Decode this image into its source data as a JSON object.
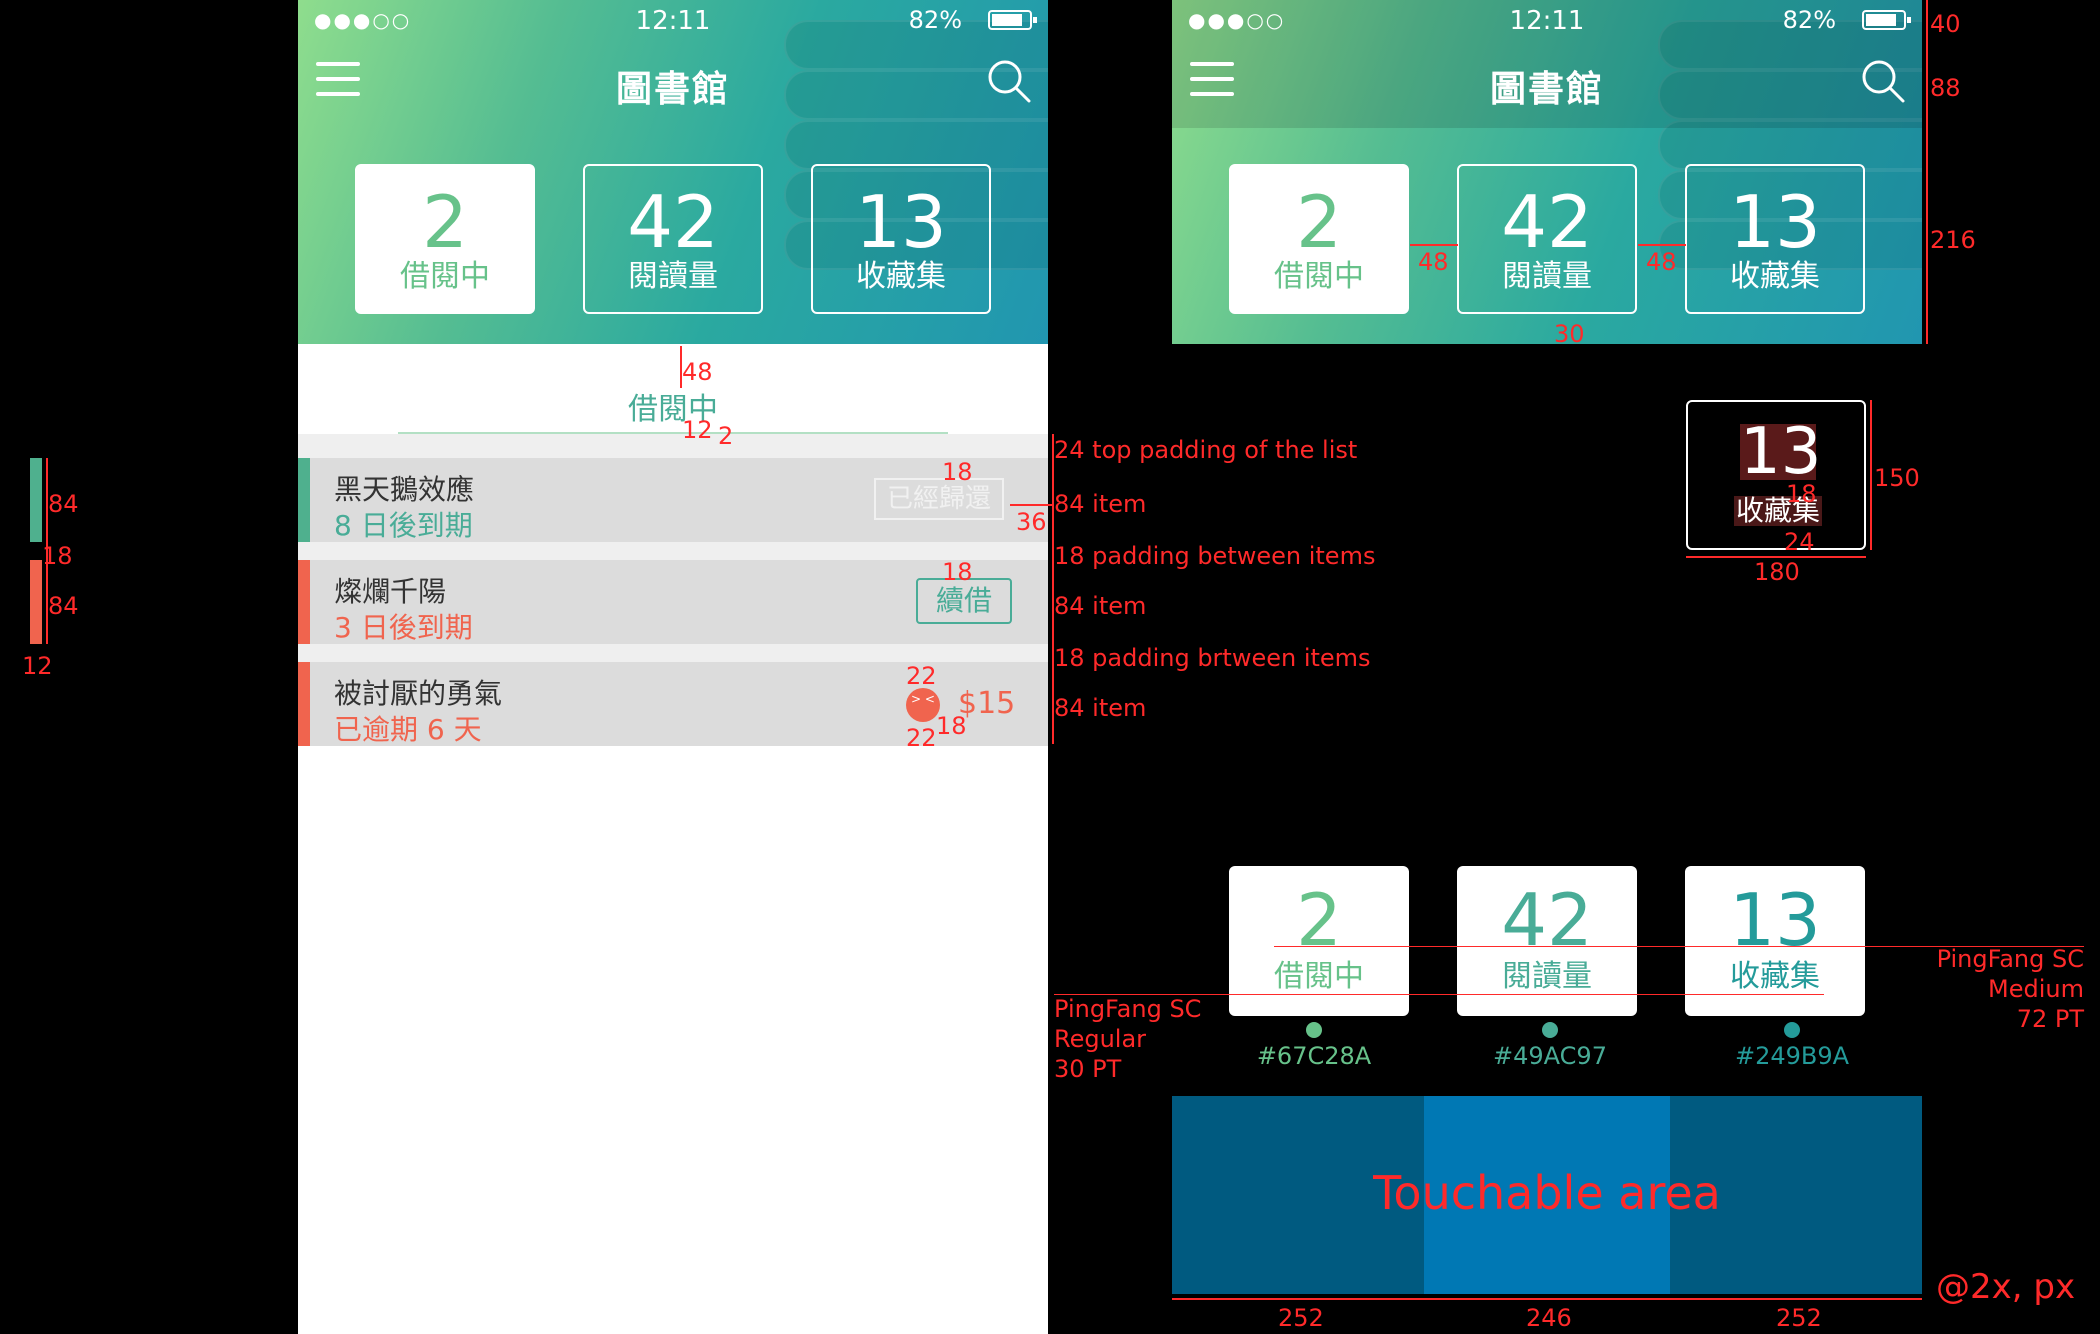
{
  "status": {
    "signal": "●●●○○",
    "time": "12:11",
    "battery": "82%"
  },
  "nav": {
    "title": "圖書館"
  },
  "stats": [
    {
      "num": "2",
      "label": "借閱中",
      "color": "#67C28A"
    },
    {
      "num": "42",
      "label": "閱讀量",
      "color": "#49AC97"
    },
    {
      "num": "13",
      "label": "收藏集",
      "color": "#249B9A"
    }
  ],
  "tab": {
    "title": "借閱中"
  },
  "items": [
    {
      "title": "黑天鵝效應",
      "subtitle": "8 日後到期",
      "bar_color": "#4fb08e",
      "sub_color": "#49ac97",
      "ghost": "已經歸還"
    },
    {
      "title": "燦爛千陽",
      "subtitle": "3 日後到期",
      "bar_color": "#f0644e",
      "sub_color": "#f0644e",
      "action": "續借"
    },
    {
      "title": "被討厭的勇氣",
      "subtitle": "已逾期 6 天",
      "bar_color": "#f0644e",
      "sub_color": "#f0644e",
      "fine": "$15"
    }
  ],
  "annotations": {
    "a48": "48",
    "a12": "12",
    "a2": "2",
    "list_top": "24 top padding of the list",
    "item1": "84 item",
    "pad1": "18 padding between items",
    "item2": "84 item",
    "pad2": "18 padding brtween items",
    "item3": "84 item",
    "r18a": "18",
    "r36": "36",
    "r18b": "18",
    "r22a": "22",
    "r22b": "22",
    "r18c": "18",
    "left84a": "84",
    "left18": "18",
    "left84b": "84",
    "left12": "12",
    "p2_40": "40",
    "p2_88": "88",
    "p2_216": "216",
    "p2_48a": "48",
    "p2_48b": "48",
    "p2_30": "30",
    "z150": "150",
    "z180": "180",
    "z18": "18",
    "z24": "24",
    "font_reg": [
      "PingFang SC",
      "Regular",
      "30 PT"
    ],
    "font_med": [
      "PingFang SC",
      "Medium",
      "72 PT"
    ],
    "touch_label": "Touchable area",
    "w1": "252",
    "w2": "246",
    "w3": "252",
    "scale": "@2x, px"
  },
  "colors": {
    "touch_dark": "#005a80",
    "touch_light": "#0078b4"
  }
}
